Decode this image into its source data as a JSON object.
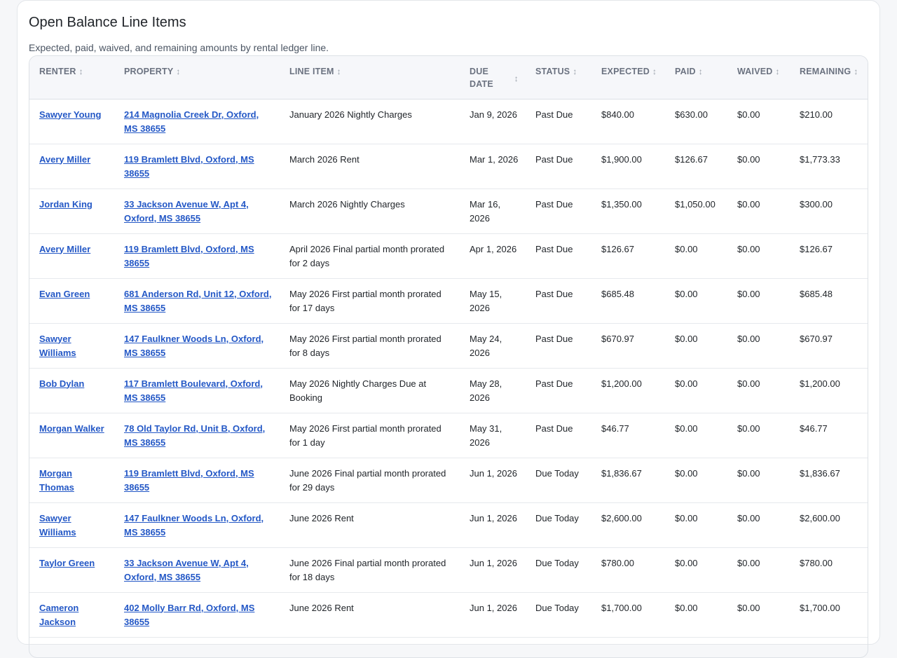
{
  "page": {
    "title": "Open Balance Line Items",
    "subtitle": "Expected, paid, waived, and remaining amounts by rental ledger line."
  },
  "table": {
    "headers": {
      "renter": "RENTER",
      "property": "PROPERTY",
      "line_item": "LINE ITEM",
      "due_date": "DUE DATE",
      "status": "STATUS",
      "expected": "EXPECTED",
      "paid": "PAID",
      "waived": "WAIVED",
      "remaining": "REMAINING"
    },
    "sort_icon": "↕",
    "rows": [
      {
        "renter": "Sawyer Young",
        "property": "214 Magnolia Creek Dr, Oxford, MS 38655",
        "line_item": "January 2026 Nightly Charges",
        "due_date": "Jan 9, 2026",
        "status": "Past Due",
        "expected": "$840.00",
        "paid": "$630.00",
        "waived": "$0.00",
        "remaining": "$210.00"
      },
      {
        "renter": "Avery Miller",
        "property": "119 Bramlett Blvd, Oxford, MS 38655",
        "line_item": "March 2026 Rent",
        "due_date": "Mar 1, 2026",
        "status": "Past Due",
        "expected": "$1,900.00",
        "paid": "$126.67",
        "waived": "$0.00",
        "remaining": "$1,773.33"
      },
      {
        "renter": "Jordan King",
        "property": "33 Jackson Avenue W, Apt 4, Oxford, MS 38655",
        "line_item": "March 2026 Nightly Charges",
        "due_date": "Mar 16, 2026",
        "status": "Past Due",
        "expected": "$1,350.00",
        "paid": "$1,050.00",
        "waived": "$0.00",
        "remaining": "$300.00"
      },
      {
        "renter": "Avery Miller",
        "property": "119 Bramlett Blvd, Oxford, MS 38655",
        "line_item": "April 2026 Final partial month prorated for 2 days",
        "due_date": "Apr 1, 2026",
        "status": "Past Due",
        "expected": "$126.67",
        "paid": "$0.00",
        "waived": "$0.00",
        "remaining": "$126.67"
      },
      {
        "renter": "Evan Green",
        "property": "681 Anderson Rd, Unit 12, Oxford, MS 38655",
        "line_item": "May 2026 First partial month prorated for 17 days",
        "due_date": "May 15, 2026",
        "status": "Past Due",
        "expected": "$685.48",
        "paid": "$0.00",
        "waived": "$0.00",
        "remaining": "$685.48"
      },
      {
        "renter": "Sawyer Williams",
        "property": "147 Faulkner Woods Ln, Oxford, MS 38655",
        "line_item": "May 2026 First partial month prorated for 8 days",
        "due_date": "May 24, 2026",
        "status": "Past Due",
        "expected": "$670.97",
        "paid": "$0.00",
        "waived": "$0.00",
        "remaining": "$670.97"
      },
      {
        "renter": "Bob Dylan",
        "property": "117 Bramlett Boulevard, Oxford, MS 38655",
        "line_item": "May 2026 Nightly Charges Due at Booking",
        "due_date": "May 28, 2026",
        "status": "Past Due",
        "expected": "$1,200.00",
        "paid": "$0.00",
        "waived": "$0.00",
        "remaining": "$1,200.00"
      },
      {
        "renter": "Morgan Walker",
        "property": "78 Old Taylor Rd, Unit B, Oxford, MS 38655",
        "line_item": "May 2026 First partial month prorated for 1 day",
        "due_date": "May 31, 2026",
        "status": "Past Due",
        "expected": "$46.77",
        "paid": "$0.00",
        "waived": "$0.00",
        "remaining": "$46.77"
      },
      {
        "renter": "Morgan Thomas",
        "property": "119 Bramlett Blvd, Oxford, MS 38655",
        "line_item": "June 2026 Final partial month prorated for 29 days",
        "due_date": "Jun 1, 2026",
        "status": "Due Today",
        "expected": "$1,836.67",
        "paid": "$0.00",
        "waived": "$0.00",
        "remaining": "$1,836.67"
      },
      {
        "renter": "Sawyer Williams",
        "property": "147 Faulkner Woods Ln, Oxford, MS 38655",
        "line_item": "June 2026 Rent",
        "due_date": "Jun 1, 2026",
        "status": "Due Today",
        "expected": "$2,600.00",
        "paid": "$0.00",
        "waived": "$0.00",
        "remaining": "$2,600.00"
      },
      {
        "renter": "Taylor Green",
        "property": "33 Jackson Avenue W, Apt 4, Oxford, MS 38655",
        "line_item": "June 2026 Final partial month prorated for 18 days",
        "due_date": "Jun 1, 2026",
        "status": "Due Today",
        "expected": "$780.00",
        "paid": "$0.00",
        "waived": "$0.00",
        "remaining": "$780.00"
      },
      {
        "renter": "Cameron Jackson",
        "property": "402 Molly Barr Rd, Oxford, MS 38655",
        "line_item": "June 2026 Rent",
        "due_date": "Jun 1, 2026",
        "status": "Due Today",
        "expected": "$1,700.00",
        "paid": "$0.00",
        "waived": "$0.00",
        "remaining": "$1,700.00"
      }
    ]
  },
  "colors": {
    "link": "#2458c6",
    "header_bg": "#f6f7fa",
    "border": "#dde1e6"
  }
}
